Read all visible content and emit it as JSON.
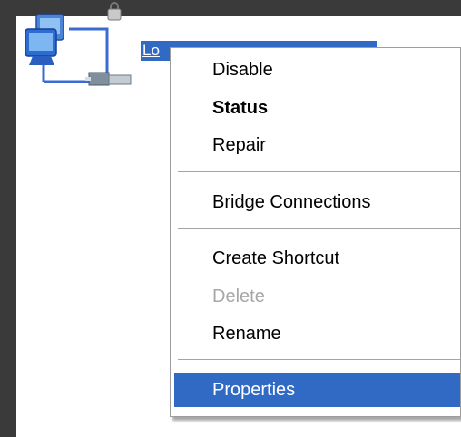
{
  "colors": {
    "selection": "#316ac5",
    "menu_background": "#ffffff",
    "disabled_text": "#a7a7a7",
    "frame": "#3a3a3a"
  },
  "connection": {
    "icon": "network-connection-icon",
    "label": "Lo"
  },
  "context_menu": {
    "items": [
      {
        "label": "Disable",
        "state": "normal"
      },
      {
        "label": "Status",
        "state": "default-bold"
      },
      {
        "label": "Repair",
        "state": "normal"
      },
      {
        "label": "Bridge Connections",
        "state": "normal"
      },
      {
        "label": "Create Shortcut",
        "state": "normal"
      },
      {
        "label": "Delete",
        "state": "disabled"
      },
      {
        "label": "Rename",
        "state": "normal"
      },
      {
        "label": "Properties",
        "state": "highlighted"
      }
    ]
  }
}
